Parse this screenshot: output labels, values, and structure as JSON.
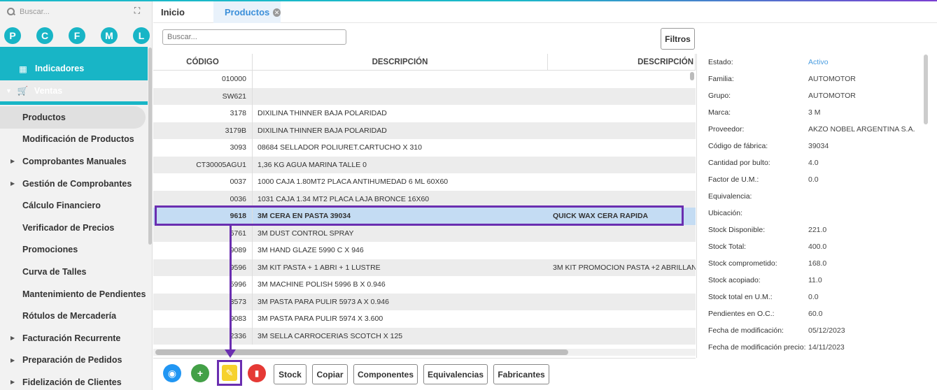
{
  "sidebar": {
    "search_placeholder": "Buscar...",
    "letters": [
      "P",
      "C",
      "F",
      "M",
      "L"
    ],
    "indicadores": "Indicadores",
    "ventas": "Ventas",
    "items": [
      {
        "label": "Productos",
        "arrow": false
      },
      {
        "label": "Modificación de Productos",
        "arrow": false
      },
      {
        "label": "Comprobantes Manuales",
        "arrow": true
      },
      {
        "label": "Gestión de Comprobantes",
        "arrow": true
      },
      {
        "label": "Cálculo Financiero",
        "arrow": false
      },
      {
        "label": "Verificador de Precios",
        "arrow": false
      },
      {
        "label": "Promociones",
        "arrow": false
      },
      {
        "label": "Curva de Talles",
        "arrow": false
      },
      {
        "label": "Mantenimiento de Pendientes",
        "arrow": false
      },
      {
        "label": "Rótulos de Mercadería",
        "arrow": false
      },
      {
        "label": "Facturación Recurrente",
        "arrow": true
      },
      {
        "label": "Preparación de Pedidos",
        "arrow": true
      },
      {
        "label": "Fidelización de Clientes",
        "arrow": true
      }
    ]
  },
  "tabs": {
    "inicio": "Inicio",
    "productos": "Productos"
  },
  "search": {
    "placeholder": "Buscar..."
  },
  "filtros": "Filtros",
  "table": {
    "headers": [
      "CÓDIGO",
      "DESCRIPCIÓN",
      "DESCRIPCIÓN"
    ],
    "rows": [
      [
        "010000",
        "",
        ""
      ],
      [
        "SW621",
        "",
        ""
      ],
      [
        "3178",
        "DIXILINA THINNER BAJA POLARIDAD",
        ""
      ],
      [
        "3179B",
        "DIXILINA THINNER BAJA POLARIDAD",
        ""
      ],
      [
        "3093",
        "08684 SELLADOR POLIURET.CARTUCHO X 310",
        ""
      ],
      [
        "CT30005AGU1",
        "1,36 KG AGUA MARINA TALLE 0",
        ""
      ],
      [
        "0037",
        "1000 CAJA 1.80MT2 PLACA ANTIHUMEDAD 6 ML 60X60",
        ""
      ],
      [
        "0036",
        "1031 CAJA 1.34 MT2 PLACA LAJA BRONCE 16X60",
        ""
      ],
      [
        "9618",
        "3M CERA EN PASTA 39034",
        "QUICK WAX CERA RAPIDA"
      ],
      [
        "5761",
        "3M DUST CONTROL SPRAY",
        ""
      ],
      [
        "9089",
        "3M HAND GLAZE 5990 C X 946",
        ""
      ],
      [
        "9596",
        "3M KIT PASTA + 1 ABRI + 1 LUSTRE",
        "3M KIT PROMOCION PASTA +2 ABRILLAN"
      ],
      [
        "5996",
        "3M MACHINE POLISH 5996 B X 0.946",
        ""
      ],
      [
        "3573",
        "3M PASTA PARA PULIR 5973 A X 0.946",
        ""
      ],
      [
        "9083",
        "3M PASTA PARA PULIR 5974 X 3.600",
        ""
      ],
      [
        "2336",
        "3M SELLA CARROCERIAS SCOTCH X 125",
        ""
      ]
    ]
  },
  "toolbar": {
    "stock": "Stock",
    "copiar": "Copiar",
    "componentes": "Componentes",
    "equivalencias": "Equivalencias",
    "fabricantes": "Fabricantes",
    "colors": {
      "view": "#2196f3",
      "add": "#43a047",
      "edit": "#f6d22c",
      "delete": "#e53935",
      "highlight": "#6a2eb0",
      "accent": "#18b5c6"
    }
  },
  "panel": [
    {
      "label": "Estado:",
      "value": "Activo"
    },
    {
      "label": "Familia:",
      "value": "AUTOMOTOR"
    },
    {
      "label": "Grupo:",
      "value": "AUTOMOTOR"
    },
    {
      "label": "Marca:",
      "value": "3 M"
    },
    {
      "label": "Proveedor:",
      "value": "AKZO NOBEL ARGENTINA S.A."
    },
    {
      "label": "Código de fábrica:",
      "value": "39034"
    },
    {
      "label": "Cantidad por bulto:",
      "value": "4.0"
    },
    {
      "label": "Factor de U.M.:",
      "value": "0.0"
    },
    {
      "label": "Equivalencia:",
      "value": ""
    },
    {
      "label": "Ubicación:",
      "value": ""
    },
    {
      "label": "Stock Disponible:",
      "value": "221.0"
    },
    {
      "label": "Stock Total:",
      "value": "400.0"
    },
    {
      "label": "Stock comprometido:",
      "value": "168.0"
    },
    {
      "label": "Stock acopiado:",
      "value": "11.0"
    },
    {
      "label": "Stock total en U.M.:",
      "value": "0.0"
    },
    {
      "label": "Pendientes en O.C.:",
      "value": "60.0"
    },
    {
      "label": "Fecha de modificación:",
      "value": "05/12/2023"
    },
    {
      "label": "Fecha de modificación precio:",
      "value": "14/11/2023"
    }
  ]
}
